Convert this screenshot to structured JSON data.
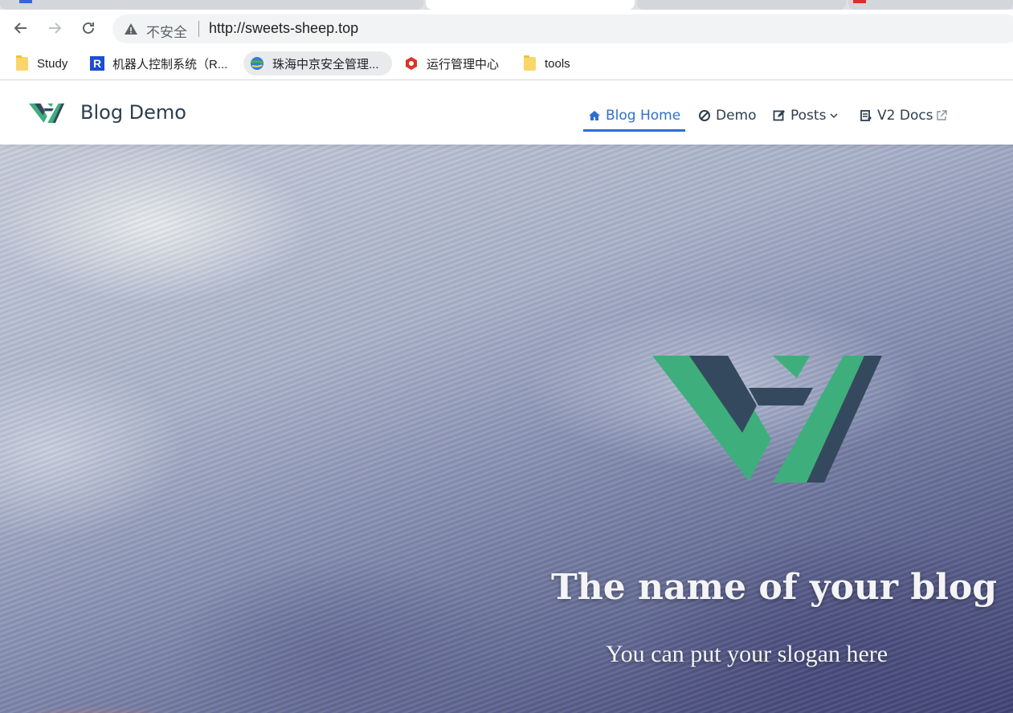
{
  "browser": {
    "nav": {
      "back_icon": "arrow-left-icon",
      "forward_icon": "arrow-right-icon",
      "reload_icon": "reload-icon"
    },
    "address_bar": {
      "security_label": "不安全",
      "url": "http://sweets-sheep.top",
      "warning_icon": "warning-triangle-icon"
    },
    "bookmarks": [
      {
        "label": "Study",
        "icon": "folder-icon"
      },
      {
        "label": "机器人控制系统（R...",
        "icon": "r-badge-icon"
      },
      {
        "label": "珠海中京安全管理...",
        "icon": "globe-icon"
      },
      {
        "label": "运行管理中心",
        "icon": "hexagon-icon"
      },
      {
        "label": "tools",
        "icon": "folder-icon"
      }
    ]
  },
  "site": {
    "brand": {
      "name": "Blog Demo",
      "logo_icon": "vh-logo-icon"
    },
    "nav": [
      {
        "label": "Blog Home",
        "icon": "home-icon",
        "active": true
      },
      {
        "label": "Demo",
        "icon": "blocked-icon"
      },
      {
        "label": "Posts",
        "icon": "edit-icon"
      },
      {
        "label": "V2 Docs",
        "icon": "docs-icon"
      }
    ],
    "hero": {
      "title": "The name of your blog",
      "slogan": "You can put your slogan here"
    }
  },
  "colors": {
    "accent": "#2e6fd1",
    "brand_green": "#3eaf7c",
    "brand_dark": "#35495e",
    "text": "#2c3e50"
  }
}
